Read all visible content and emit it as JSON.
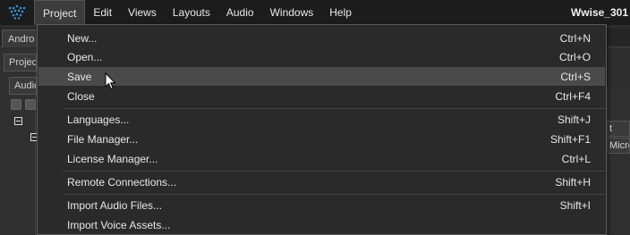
{
  "menubar": {
    "logo_icon": "wwise-logo-icon",
    "items": [
      {
        "label": "Project",
        "active": true
      },
      {
        "label": "Edit"
      },
      {
        "label": "Views"
      },
      {
        "label": "Layouts"
      },
      {
        "label": "Audio"
      },
      {
        "label": "Windows"
      },
      {
        "label": "Help"
      }
    ],
    "window_title": "Wwise_301"
  },
  "background": {
    "top_tab": "Andro",
    "panel_tab": "Projec",
    "audio_tab": "Audio",
    "right_field_1": "t",
    "right_field_2": "Micro"
  },
  "project_menu": {
    "items": [
      {
        "label": "New...",
        "shortcut": "Ctrl+N"
      },
      {
        "label": "Open...",
        "shortcut": "Ctrl+O"
      },
      {
        "label": "Save",
        "shortcut": "Ctrl+S",
        "highlighted": true
      },
      {
        "label": "Close",
        "shortcut": "Ctrl+F4"
      },
      {
        "label": "Languages...",
        "shortcut": "Shift+J"
      },
      {
        "label": "File Manager...",
        "shortcut": "Shift+F1"
      },
      {
        "label": "License Manager...",
        "shortcut": "Ctrl+L"
      },
      {
        "label": "Remote Connections...",
        "shortcut": "Shift+H"
      },
      {
        "label": "Import Audio Files...",
        "shortcut": "Shift+I"
      },
      {
        "label": "Import Voice Assets...",
        "shortcut": ""
      }
    ]
  },
  "colors": {
    "menubar_bg": "#1c1c1c",
    "menu_bg": "#2a2a2a",
    "highlight": "#4a4a4a",
    "text": "#e8e8e8",
    "logo_blue": "#3a8fd6"
  }
}
